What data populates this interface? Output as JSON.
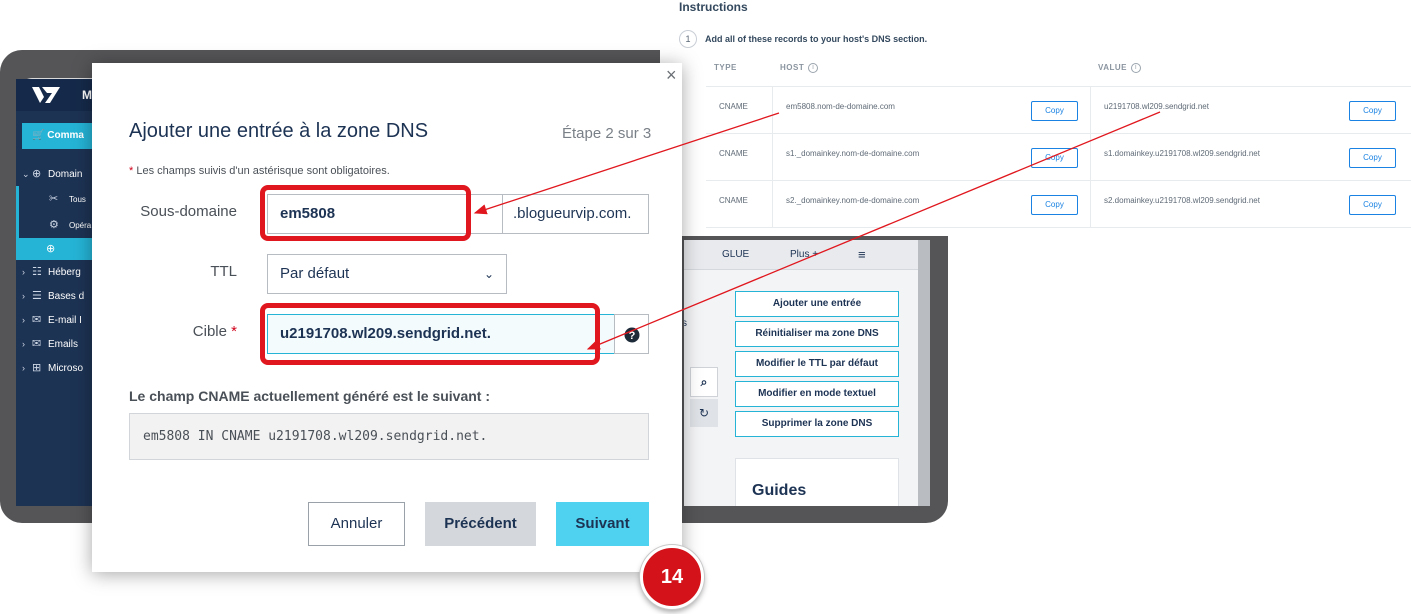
{
  "colors": {
    "ovh_navy": "#1d3354",
    "ovh_cyan": "#25b4d6",
    "highlight_red": "#e0171e",
    "primary_button": "#4fd2f0",
    "sendgrid_blue": "#1a82e2"
  },
  "ovh_sidebar": {
    "logo_letter": "M",
    "commander_label": "Comma",
    "nav": [
      {
        "label": "Domain",
        "icon": "globe-icon"
      },
      {
        "label": "Héberg",
        "icon": "hosting-icon"
      },
      {
        "label": "Bases d",
        "icon": "database-icon"
      },
      {
        "label": "E-mail I",
        "icon": "mail-icon"
      },
      {
        "label": "Emails",
        "icon": "mail-icon"
      },
      {
        "label": "Microso",
        "icon": "windows-icon"
      }
    ],
    "domain_subitems": [
      {
        "label": "Tous",
        "icon": "tools-icon"
      },
      {
        "label": "Opéra",
        "icon": "gear-icon"
      }
    ]
  },
  "ovh_dns_panel": {
    "tabs": [
      "GLUE",
      "Plus +"
    ],
    "actions": [
      "Ajouter une entrée",
      "Réinitialiser ma zone DNS",
      "Modifier le TTL par défaut",
      "Modifier en mode textuel",
      "Supprimer la zone DNS"
    ],
    "guides_title": "Guides",
    "stray_char": "s"
  },
  "sendgrid": {
    "title": "Instructions",
    "step_number": "1",
    "step_text": "Add all of these records to your host's DNS section.",
    "headers": {
      "type": "TYPE",
      "host": "HOST",
      "value": "VALUE"
    },
    "copy_label": "Copy",
    "records": [
      {
        "type": "CNAME",
        "host": "em5808.nom-de-domaine.com",
        "value": "u2191708.wl209.sendgrid.net"
      },
      {
        "type": "CNAME",
        "host": "s1._domainkey.nom-de-domaine.com",
        "value": "s1.domainkey.u2191708.wl209.sendgrid.net"
      },
      {
        "type": "CNAME",
        "host": "s2._domainkey.nom-de-domaine.com",
        "value": "s2.domainkey.u2191708.wl209.sendgrid.net"
      }
    ]
  },
  "modal": {
    "close": "×",
    "title": "Ajouter une entrée à la zone DNS",
    "step": "Étape 2 sur 3",
    "required_note": "Les champs suivis d'un astérisque sont obligatoires.",
    "asterisk": "*",
    "subdomain_label": "Sous-domaine",
    "subdomain_value": "em5808",
    "subdomain_suffix": ".blogueurvip.com.",
    "ttl_label": "TTL",
    "ttl_value": "Par défaut",
    "target_label": "Cible",
    "target_value": "u2191708.wl209.sendgrid.net.",
    "cname_label": "Le champ CNAME actuellement généré est le suivant :",
    "cname_value": "em5808 IN CNAME u2191708.wl209.sendgrid.net.",
    "buttons": {
      "cancel": "Annuler",
      "previous": "Précédent",
      "next": "Suivant"
    }
  },
  "badge": "14"
}
